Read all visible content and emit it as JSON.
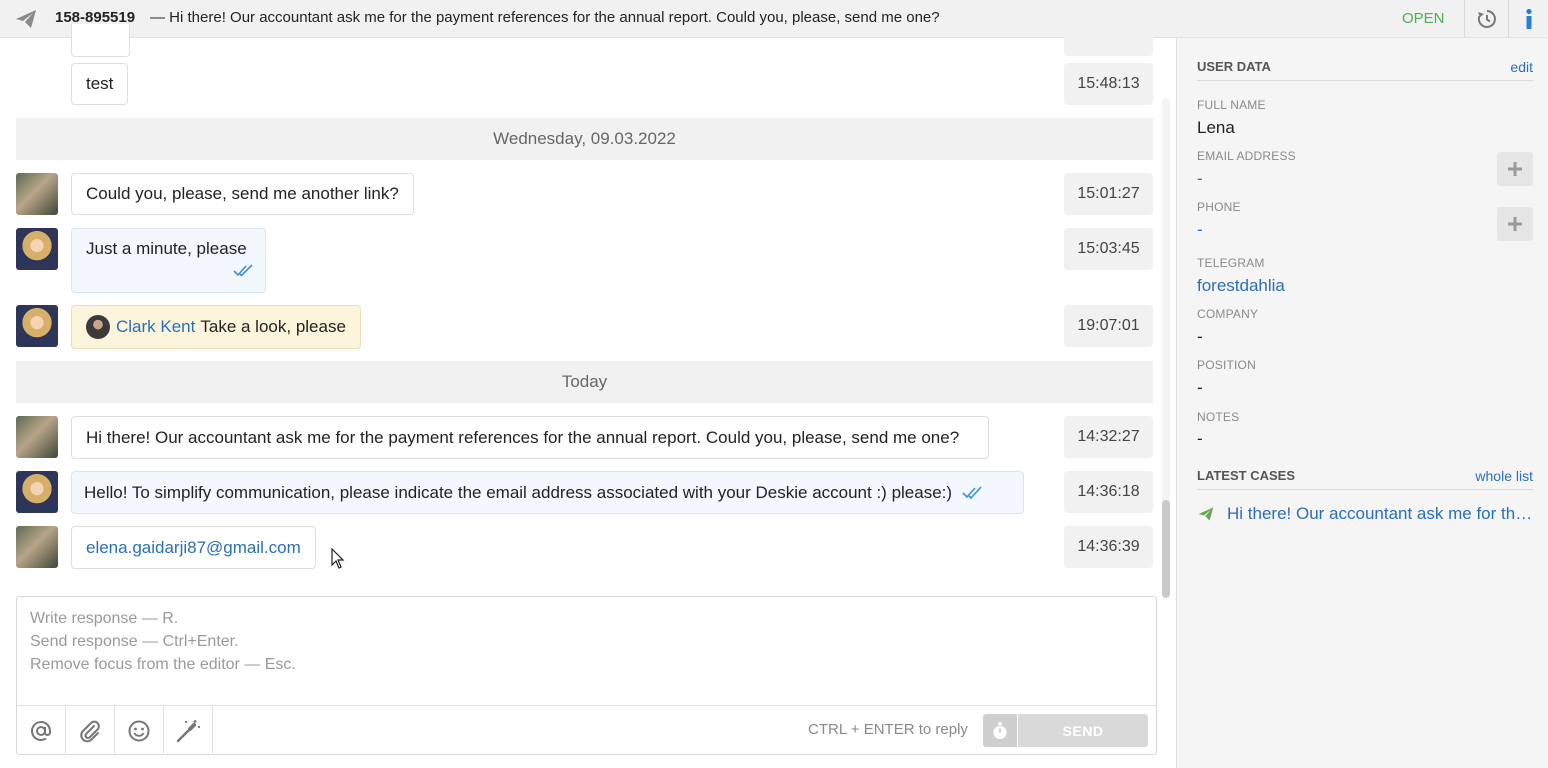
{
  "header": {
    "case_id": "158-895519",
    "subject": "— Hi there! Our accountant ask me for the payment references for the annual report. Could you, please, send me one?",
    "status": "OPEN",
    "icons": {
      "channel": "telegram-plane-icon",
      "history": "history-icon",
      "info": "info-icon"
    },
    "status_color": "#4caf50"
  },
  "messages": [
    {
      "text": "test",
      "time": "15:48:13",
      "direction": "in"
    },
    {
      "date": "Wednesday, 09.03.2022"
    },
    {
      "text": "Could you, please, send me another link?",
      "time": "15:01:27",
      "direction": "in"
    },
    {
      "text": "Just a minute, please",
      "time": "15:03:45",
      "direction": "out"
    },
    {
      "mention": "Clark Kent",
      "text": "Take a look, please",
      "time": "19:07:01",
      "direction": "note"
    },
    {
      "date": "Today"
    },
    {
      "text": "Hi there! Our accountant ask me for the payment references for the annual report. Could you, please, send me one?",
      "time": "14:32:27",
      "direction": "in"
    },
    {
      "text": "Hello! To simplify communication, please indicate the email address associated with your Deskie account :) please:)",
      "time": "14:36:18",
      "direction": "out"
    },
    {
      "text": "elena.gaidarji87@gmail.com",
      "time": "14:36:39",
      "direction": "in"
    }
  ],
  "editor": {
    "placeholder_lines": [
      "Write response — R.",
      "Send response — Ctrl+Enter.",
      "Remove focus from the editor — Esc."
    ],
    "tools": [
      "at-icon",
      "paperclip-icon",
      "smile-icon",
      "magic-wand-icon"
    ],
    "hint": "CTRL + ENTER to reply",
    "send_label": "SEND"
  },
  "sidebar": {
    "user_data_title": "USER DATA",
    "edit_label": "edit",
    "fields": {
      "full_name": {
        "label": "FULL NAME",
        "value": "Lena"
      },
      "email": {
        "label": "EMAIL ADDRESS",
        "value": "-"
      },
      "phone": {
        "label": "PHONE",
        "value": "-"
      },
      "telegram": {
        "label": "TELEGRAM",
        "value": "forestdahlia"
      },
      "company": {
        "label": "COMPANY",
        "value": "-"
      },
      "position": {
        "label": "POSITION",
        "value": "-"
      },
      "notes": {
        "label": "NOTES",
        "value": "-"
      }
    },
    "latest_cases_title": "LATEST CASES",
    "whole_list_label": "whole list",
    "latest_case": "Hi there! Our accountant ask me for the payment references for the annual report. Could you, please, send me one?"
  },
  "colors": {
    "link": "#2a6fb5",
    "outgoing_bubble": "#f2f8fd",
    "note_bubble": "#fdf4dc",
    "channel_icon": "#6aa84f"
  }
}
